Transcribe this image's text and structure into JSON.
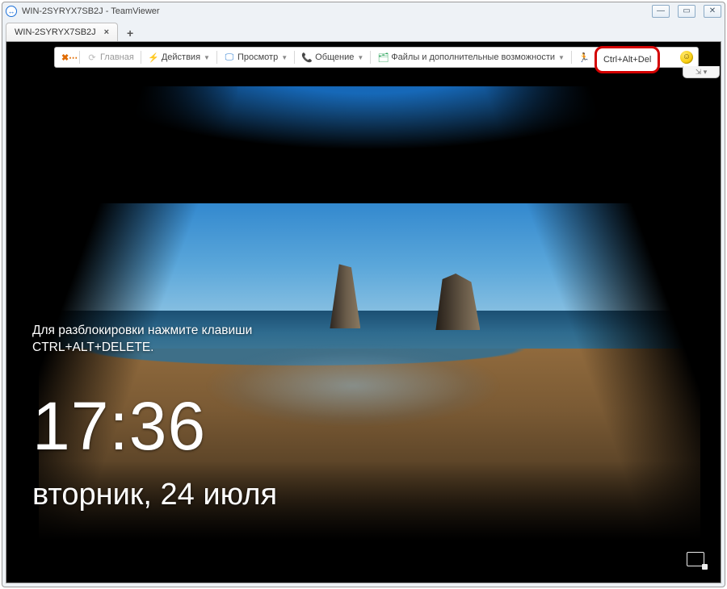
{
  "window": {
    "title": "WIN-2SYRYX7SB2J - TeamViewer"
  },
  "tabs": {
    "active": {
      "label": "WIN-2SYRYX7SB2J"
    }
  },
  "toolbar": {
    "home": "Главная",
    "actions": "Действия",
    "view": "Просмотр",
    "comm": "Общение",
    "files": "Файлы и дополнительные возможности",
    "cad": "Ctrl+Alt+Del"
  },
  "lockscreen": {
    "hint_line1": "Для разблокировки нажмите клавиши",
    "hint_line2": "CTRL+ALT+DELETE.",
    "time": "17:36",
    "date": "вторник, 24 июля"
  },
  "pin": {
    "label": "⇲ ▾"
  }
}
